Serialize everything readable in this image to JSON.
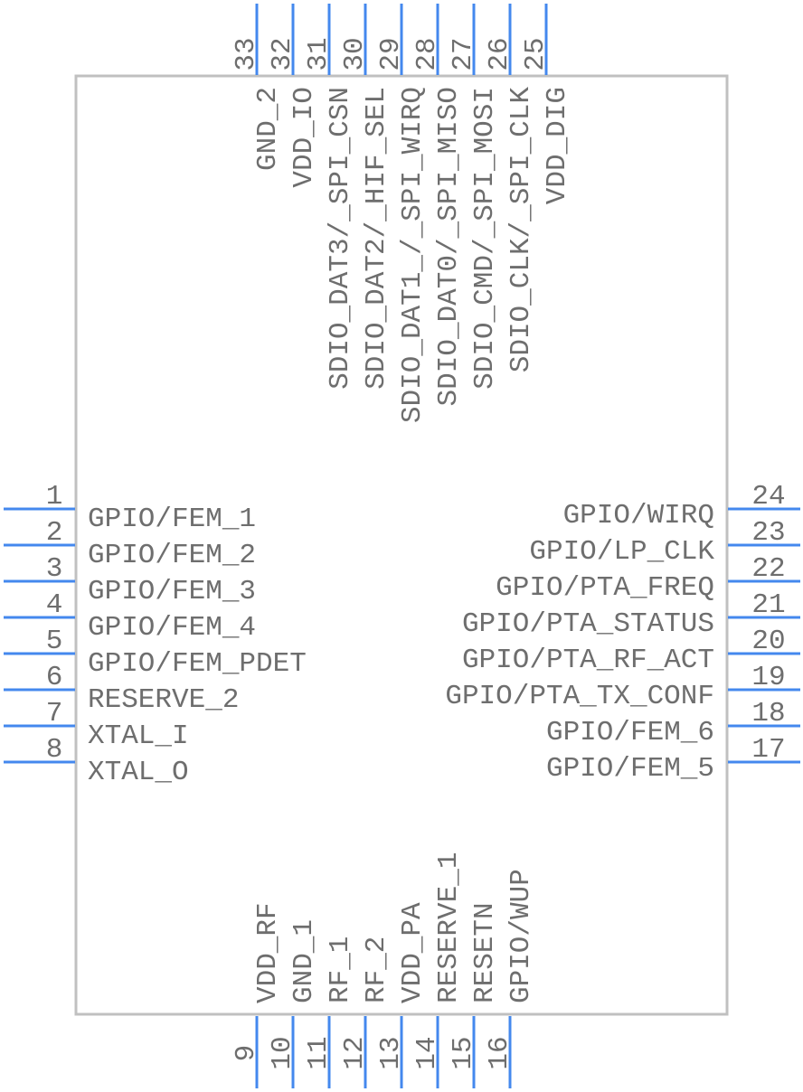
{
  "component": {
    "body_outline_color": "#c0c0c0",
    "pin_color": "#4488ee",
    "text_color": "#6e6e6e"
  },
  "pins": {
    "left": [
      {
        "number": "1",
        "name": "GPIO/FEM_1"
      },
      {
        "number": "2",
        "name": "GPIO/FEM_2"
      },
      {
        "number": "3",
        "name": "GPIO/FEM_3"
      },
      {
        "number": "4",
        "name": "GPIO/FEM_4"
      },
      {
        "number": "5",
        "name": "GPIO/FEM_PDET"
      },
      {
        "number": "6",
        "name": "RESERVE_2"
      },
      {
        "number": "7",
        "name": "XTAL_I"
      },
      {
        "number": "8",
        "name": "XTAL_O"
      }
    ],
    "bottom": [
      {
        "number": "9",
        "name": "VDD_RF"
      },
      {
        "number": "10",
        "name": "GND_1"
      },
      {
        "number": "11",
        "name": "RF_1"
      },
      {
        "number": "12",
        "name": "RF_2"
      },
      {
        "number": "13",
        "name": "VDD_PA"
      },
      {
        "number": "14",
        "name": "RESERVE_1"
      },
      {
        "number": "15",
        "name": "RESETN"
      },
      {
        "number": "16",
        "name": "GPIO/WUP"
      }
    ],
    "right": [
      {
        "number": "24",
        "name": "GPIO/WIRQ"
      },
      {
        "number": "23",
        "name": "GPIO/LP_CLK"
      },
      {
        "number": "22",
        "name": "GPIO/PTA_FREQ"
      },
      {
        "number": "21",
        "name": "GPIO/PTA_STATUS"
      },
      {
        "number": "20",
        "name": "GPIO/PTA_RF_ACT"
      },
      {
        "number": "19",
        "name": "GPIO/PTA_TX_CONF"
      },
      {
        "number": "18",
        "name": "GPIO/FEM_6"
      },
      {
        "number": "17",
        "name": "GPIO/FEM_5"
      }
    ],
    "top": [
      {
        "number": "33",
        "name": "GND_2"
      },
      {
        "number": "32",
        "name": "VDD_IO"
      },
      {
        "number": "31",
        "name": "SDIO_DAT3/_SPI_CSN"
      },
      {
        "number": "30",
        "name": "SDIO_DAT2/_HIF_SEL"
      },
      {
        "number": "29",
        "name": "SDIO_DAT1_/_SPI_WIRQ"
      },
      {
        "number": "28",
        "name": "SDIO_DAT0/_SPI_MISO"
      },
      {
        "number": "27",
        "name": "SDIO_CMD/_SPI_MOSI"
      },
      {
        "number": "26",
        "name": "SDIO_CLK/_SPI_CLK"
      },
      {
        "number": "25",
        "name": "VDD_DIG"
      }
    ]
  }
}
